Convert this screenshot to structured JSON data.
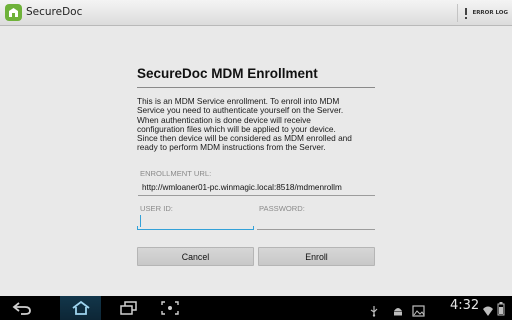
{
  "app": {
    "title": "SecureDoc"
  },
  "action_bar": {
    "error_log_label": "ERROR LOG"
  },
  "dialog": {
    "title": "SecureDoc MDM Enrollment",
    "intro_lines": [
      "This is an MDM Service enrollment. To enroll into MDM",
      "Service you need to authenticate yourself on the Server.",
      "When authentication is done device will receive",
      "configuration files which will be applied to your device.",
      "Since then device will be considered as MDM enrolled and",
      "ready to perform MDM instructions from the Server."
    ]
  },
  "form": {
    "enrollment_url": {
      "label": "ENROLLMENT URL:",
      "value": "http://wmloaner01-pc.winmagic.local:8518/mdmenrollm"
    },
    "user_id": {
      "label": "USER ID:",
      "value": ""
    },
    "password": {
      "label": "PASSWORD:",
      "value": ""
    }
  },
  "buttons": {
    "cancel": "Cancel",
    "enroll": "Enroll"
  },
  "status_bar": {
    "time": "4:32"
  },
  "colors": {
    "accent": "#33a1d8",
    "app_icon": "#6fb23a",
    "background": "#e9e9e9"
  },
  "icons": [
    "app-icon",
    "error-log-icon",
    "back-icon",
    "home-icon",
    "recent-apps-icon",
    "screenshot-icon",
    "usb-icon",
    "android-debug-icon",
    "image-icon",
    "wifi-icon",
    "battery-icon"
  ]
}
